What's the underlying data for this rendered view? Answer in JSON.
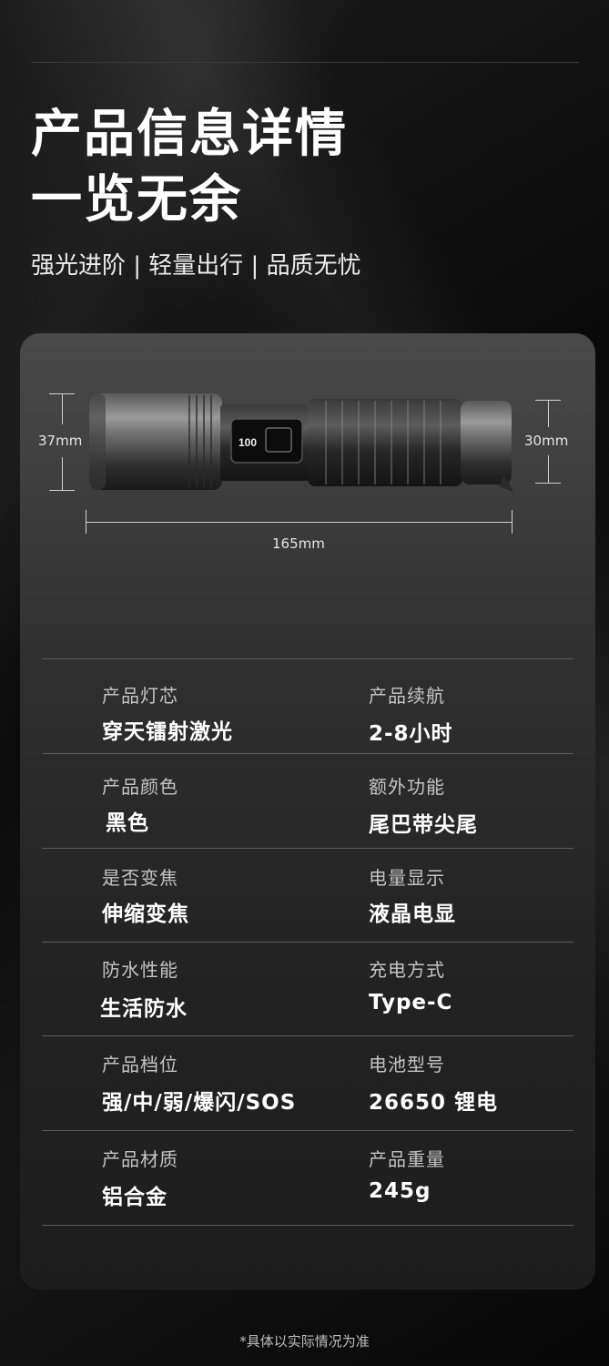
{
  "header": {
    "title_line1": "产品信息详情",
    "title_line2": "一览无余",
    "subtitle": "强光进阶 | 轻量出行 | 品质无忧"
  },
  "dimensions": {
    "head_diameter": "37mm",
    "tail_diameter": "30mm",
    "length": "165mm",
    "display_reading": "100"
  },
  "specs": [
    {
      "label": "产品灯芯",
      "value": "穿天镭射激光"
    },
    {
      "label": "产品续航",
      "value": "2-8小时"
    },
    {
      "label": "产品颜色",
      "value": "黑色"
    },
    {
      "label": "额外功能",
      "value": "尾巴带尖尾"
    },
    {
      "label": "是否变焦",
      "value": "伸缩变焦"
    },
    {
      "label": "电量显示",
      "value": "液晶电显"
    },
    {
      "label": "防水性能",
      "value": "生活防水"
    },
    {
      "label": "充电方式",
      "value": "Type-C"
    },
    {
      "label": "产品档位",
      "value": "强/中/弱/爆闪/SOS"
    },
    {
      "label": "电池型号",
      "value": "26650 锂电"
    },
    {
      "label": "产品材质",
      "value": "铝合金"
    },
    {
      "label": "产品重量",
      "value": "245g"
    }
  ],
  "footnote": "*具体以实际情况为准"
}
